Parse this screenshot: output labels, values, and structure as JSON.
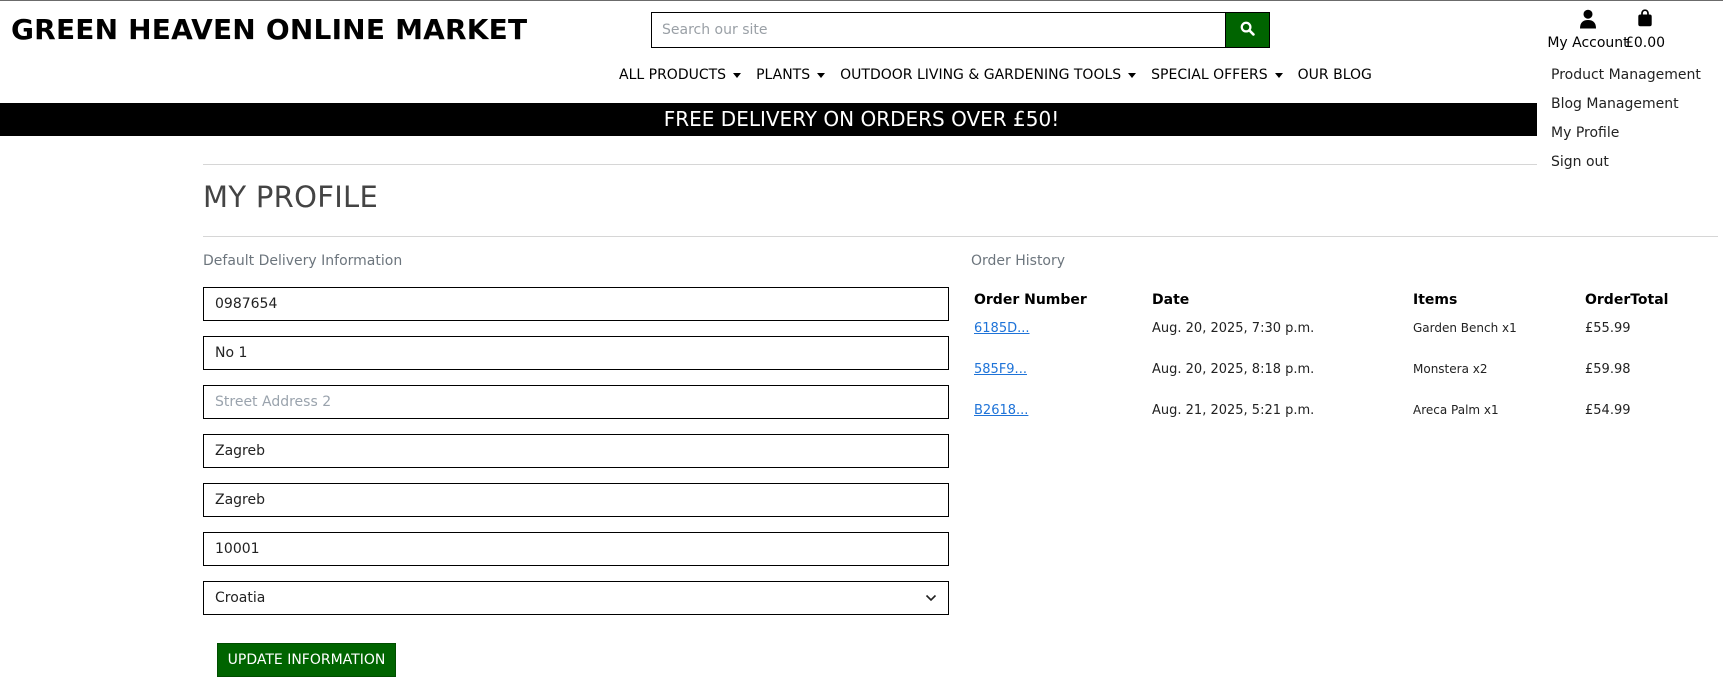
{
  "header": {
    "logo": "GREEN HEAVEN ONLINE MARKET",
    "search_placeholder": "Search our site",
    "search_icon": "search-icon",
    "account_label": "My Account",
    "account_icon": "user-icon",
    "bag_total": "£0.00",
    "bag_icon": "shopping-bag-icon",
    "accent_color": "#006400"
  },
  "nav": {
    "items": [
      {
        "label": "ALL PRODUCTS",
        "dropdown": true
      },
      {
        "label": "PLANTS",
        "dropdown": true
      },
      {
        "label": "OUTDOOR LIVING & GARDENING TOOLS",
        "dropdown": true
      },
      {
        "label": "SPECIAL OFFERS",
        "dropdown": true
      },
      {
        "label": "OUR BLOG",
        "dropdown": false
      }
    ]
  },
  "account_menu": {
    "items": [
      "Product Management",
      "Blog Management",
      "My Profile",
      "Sign out"
    ]
  },
  "banner": {
    "text": "FREE DELIVERY ON ORDERS OVER £50!"
  },
  "page": {
    "title": "MY PROFILE"
  },
  "delivery": {
    "label": "Default Delivery Information",
    "phone": "0987654",
    "street1": "No 1",
    "street2_placeholder": "Street Address 2",
    "town": "Zagreb",
    "county": "Zagreb",
    "postcode": "10001",
    "country": "Croatia",
    "update_label": "UPDATE INFORMATION"
  },
  "orders": {
    "label": "Order History",
    "headers": [
      "Order Number",
      "Date",
      "Items",
      "OrderTotal"
    ],
    "rows": [
      {
        "number": "6185D...",
        "date": "Aug. 20, 2025, 7:30 p.m.",
        "items": "Garden Bench x1",
        "total": "£55.99"
      },
      {
        "number": "585F9...",
        "date": "Aug. 20, 2025, 8:18 p.m.",
        "items": "Monstera x2",
        "total": "£59.98"
      },
      {
        "number": "B2618...",
        "date": "Aug. 21, 2025, 5:21 p.m.",
        "items": "Areca Palm x1",
        "total": "£54.99"
      }
    ]
  }
}
